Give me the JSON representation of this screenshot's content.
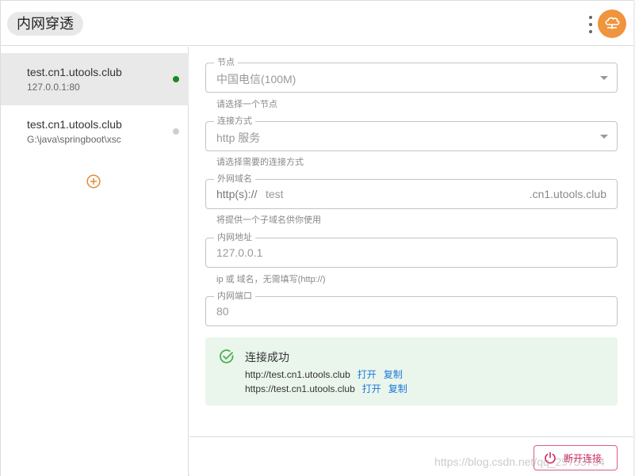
{
  "header": {
    "title": "内网穿透",
    "more_icon": "more-vertical-icon",
    "avatar_icon": "cloud-network-icon",
    "avatar_color": "#f0943e"
  },
  "sidebar": {
    "items": [
      {
        "host": "test.cn1.utools.club",
        "target": "127.0.0.1:80",
        "status": "connected",
        "status_color": "#1a8a1a"
      },
      {
        "host": "test.cn1.utools.club",
        "target": "G:\\java\\springboot\\xsc",
        "status": "idle",
        "status_color": "#cfcfcf"
      }
    ],
    "add_icon": "add-circle-icon",
    "accent": "#f0943e"
  },
  "form": {
    "node": {
      "legend": "节点",
      "value": "中国电信(100M)",
      "helper": "请选择一个节点"
    },
    "mode": {
      "legend": "连接方式",
      "value": "http 服务",
      "helper": "请选择需要的连接方式"
    },
    "domain": {
      "legend": "外网域名",
      "prefix": "http(s)://",
      "value": "test",
      "suffix": ".cn1.utools.club",
      "helper": "将提供一个子域名供你使用"
    },
    "local_addr": {
      "legend": "内网地址",
      "value": "127.0.0.1",
      "helper": "ip 或 域名，无需填写(http://)"
    },
    "local_port": {
      "legend": "内网端口",
      "value": "80"
    }
  },
  "success": {
    "title": "连接成功",
    "icon": "check-circle-icon",
    "color": "#4caf50",
    "rows": [
      {
        "url": "http://test.cn1.utools.club",
        "open": "打开",
        "copy": "复制"
      },
      {
        "url": "https://test.cn1.utools.club",
        "open": "打开",
        "copy": "复制"
      }
    ]
  },
  "footer": {
    "disconnect_label": "断开连接",
    "disconnect_icon": "power-icon",
    "disconnect_color": "#d3225a"
  },
  "watermark": "https://blog.csdn.net/qq_29753734"
}
